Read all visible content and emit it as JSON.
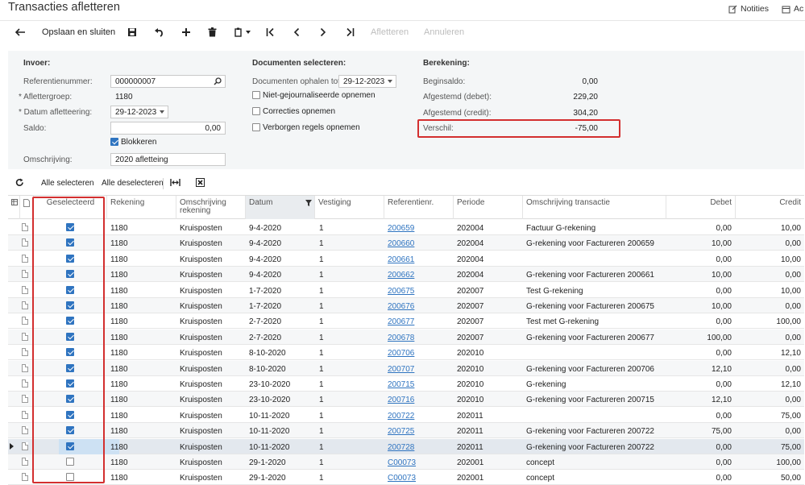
{
  "page": {
    "title": "Transacties afletteren",
    "notities": "Notities",
    "acties": "Ac"
  },
  "toolbar": {
    "save_close": "Opslaan en sluiten",
    "afletteren": "Afletteren",
    "annuleren": "Annuleren"
  },
  "invoer": {
    "title": "Invoer:",
    "ref_label": "Referentienummer:",
    "ref_value": "000000007",
    "groep_label": "* Aflettergroep:",
    "groep_value": "1180",
    "datum_label": "* Datum afletteering:",
    "datum_value": "29-12-2023",
    "saldo_label": "Saldo:",
    "saldo_value": "0,00",
    "blokkeren_label": "Blokkeren",
    "omschr_label": "Omschrijving:",
    "omschr_value": "2020 afletteing"
  },
  "documenten": {
    "title": "Documenten selecteren:",
    "ophalen_label": "Documenten ophalen tot:",
    "ophalen_value": "29-12-2023",
    "opt1": "Niet-gejournaliseerde opnemen",
    "opt2": "Correcties opnemen",
    "opt3": "Verborgen regels opnemen"
  },
  "berekening": {
    "title": "Berekening:",
    "begin_label": "Beginsaldo:",
    "begin_value": "0,00",
    "debet_label": "Afgestemd (debet):",
    "debet_value": "229,20",
    "credit_label": "Afgestemd (credit):",
    "credit_value": "304,20",
    "verschil_label": "Verschil:",
    "verschil_value": "-75,00"
  },
  "grid_toolbar": {
    "select_all": "Alle selecteren",
    "deselect_all": "Alle deselecteren"
  },
  "columns": {
    "geselecteerd": "Geselecteerd",
    "rekening": "Rekening",
    "omschr_rek_1": "Omschrijving",
    "omschr_rek_2": "rekening",
    "datum": "Datum",
    "vestiging": "Vestiging",
    "referentienr": "Referentienr.",
    "periode": "Periode",
    "omschr_trans": "Omschrijving transactie",
    "debet": "Debet",
    "credit": "Credit"
  },
  "rows": [
    {
      "checked": true,
      "rekening": "1180",
      "omschr": "Kruisposten",
      "datum": "9-4-2020",
      "vestiging": "1",
      "ref": "200659",
      "periode": "202004",
      "trans": "Factuur G-rekening",
      "debet": "0,00",
      "credit": "10,00"
    },
    {
      "checked": true,
      "rekening": "1180",
      "omschr": "Kruisposten",
      "datum": "9-4-2020",
      "vestiging": "1",
      "ref": "200660",
      "periode": "202004",
      "trans": "G-rekening voor Factureren 200659",
      "debet": "10,00",
      "credit": "0,00"
    },
    {
      "checked": true,
      "rekening": "1180",
      "omschr": "Kruisposten",
      "datum": "9-4-2020",
      "vestiging": "1",
      "ref": "200661",
      "periode": "202004",
      "trans": "",
      "debet": "0,00",
      "credit": "10,00"
    },
    {
      "checked": true,
      "rekening": "1180",
      "omschr": "Kruisposten",
      "datum": "9-4-2020",
      "vestiging": "1",
      "ref": "200662",
      "periode": "202004",
      "trans": "G-rekening voor Factureren 200661",
      "debet": "10,00",
      "credit": "0,00"
    },
    {
      "checked": true,
      "rekening": "1180",
      "omschr": "Kruisposten",
      "datum": "1-7-2020",
      "vestiging": "1",
      "ref": "200675",
      "periode": "202007",
      "trans": "Test G-rekening",
      "debet": "0,00",
      "credit": "10,00"
    },
    {
      "checked": true,
      "rekening": "1180",
      "omschr": "Kruisposten",
      "datum": "1-7-2020",
      "vestiging": "1",
      "ref": "200676",
      "periode": "202007",
      "trans": "G-rekening voor Factureren 200675",
      "debet": "10,00",
      "credit": "0,00"
    },
    {
      "checked": true,
      "rekening": "1180",
      "omschr": "Kruisposten",
      "datum": "2-7-2020",
      "vestiging": "1",
      "ref": "200677",
      "periode": "202007",
      "trans": "Test met G-rekening",
      "debet": "0,00",
      "credit": "100,00"
    },
    {
      "checked": true,
      "rekening": "1180",
      "omschr": "Kruisposten",
      "datum": "2-7-2020",
      "vestiging": "1",
      "ref": "200678",
      "periode": "202007",
      "trans": "G-rekening voor Factureren 200677",
      "debet": "100,00",
      "credit": "0,00"
    },
    {
      "checked": true,
      "rekening": "1180",
      "omschr": "Kruisposten",
      "datum": "8-10-2020",
      "vestiging": "1",
      "ref": "200706",
      "periode": "202010",
      "trans": "",
      "debet": "0,00",
      "credit": "12,10"
    },
    {
      "checked": true,
      "rekening": "1180",
      "omschr": "Kruisposten",
      "datum": "8-10-2020",
      "vestiging": "1",
      "ref": "200707",
      "periode": "202010",
      "trans": "G-rekening voor Factureren 200706",
      "debet": "12,10",
      "credit": "0,00"
    },
    {
      "checked": true,
      "rekening": "1180",
      "omschr": "Kruisposten",
      "datum": "23-10-2020",
      "vestiging": "1",
      "ref": "200715",
      "periode": "202010",
      "trans": "G-rekening",
      "debet": "0,00",
      "credit": "12,10"
    },
    {
      "checked": true,
      "rekening": "1180",
      "omschr": "Kruisposten",
      "datum": "23-10-2020",
      "vestiging": "1",
      "ref": "200716",
      "periode": "202010",
      "trans": "G-rekening voor Factureren 200715",
      "debet": "12,10",
      "credit": "0,00"
    },
    {
      "checked": true,
      "rekening": "1180",
      "omschr": "Kruisposten",
      "datum": "10-11-2020",
      "vestiging": "1",
      "ref": "200722",
      "periode": "202011",
      "trans": "",
      "debet": "0,00",
      "credit": "75,00"
    },
    {
      "checked": true,
      "rekening": "1180",
      "omschr": "Kruisposten",
      "datum": "10-11-2020",
      "vestiging": "1",
      "ref": "200725",
      "periode": "202011",
      "trans": "G-rekening voor Factureren 200722",
      "debet": "75,00",
      "credit": "0,00"
    },
    {
      "checked": true,
      "rekening": "1180",
      "omschr": "Kruisposten",
      "datum": "10-11-2020",
      "vestiging": "1",
      "ref": "200728",
      "periode": "202011",
      "trans": "G-rekening voor Factureren 200722",
      "debet": "0,00",
      "credit": "75,00"
    },
    {
      "checked": false,
      "rekening": "1180",
      "omschr": "Kruisposten",
      "datum": "29-1-2020",
      "vestiging": "1",
      "ref": "C00073",
      "periode": "202001",
      "trans": "concept",
      "debet": "0,00",
      "credit": "100,00"
    },
    {
      "checked": false,
      "rekening": "1180",
      "omschr": "Kruisposten",
      "datum": "29-1-2020",
      "vestiging": "1",
      "ref": "C00073",
      "periode": "202001",
      "trans": "concept",
      "debet": "0,00",
      "credit": "50,00"
    }
  ],
  "colors": {
    "accent": "#2f74c0",
    "highlight": "#d32f2f",
    "panel": "#f4f6f7"
  }
}
